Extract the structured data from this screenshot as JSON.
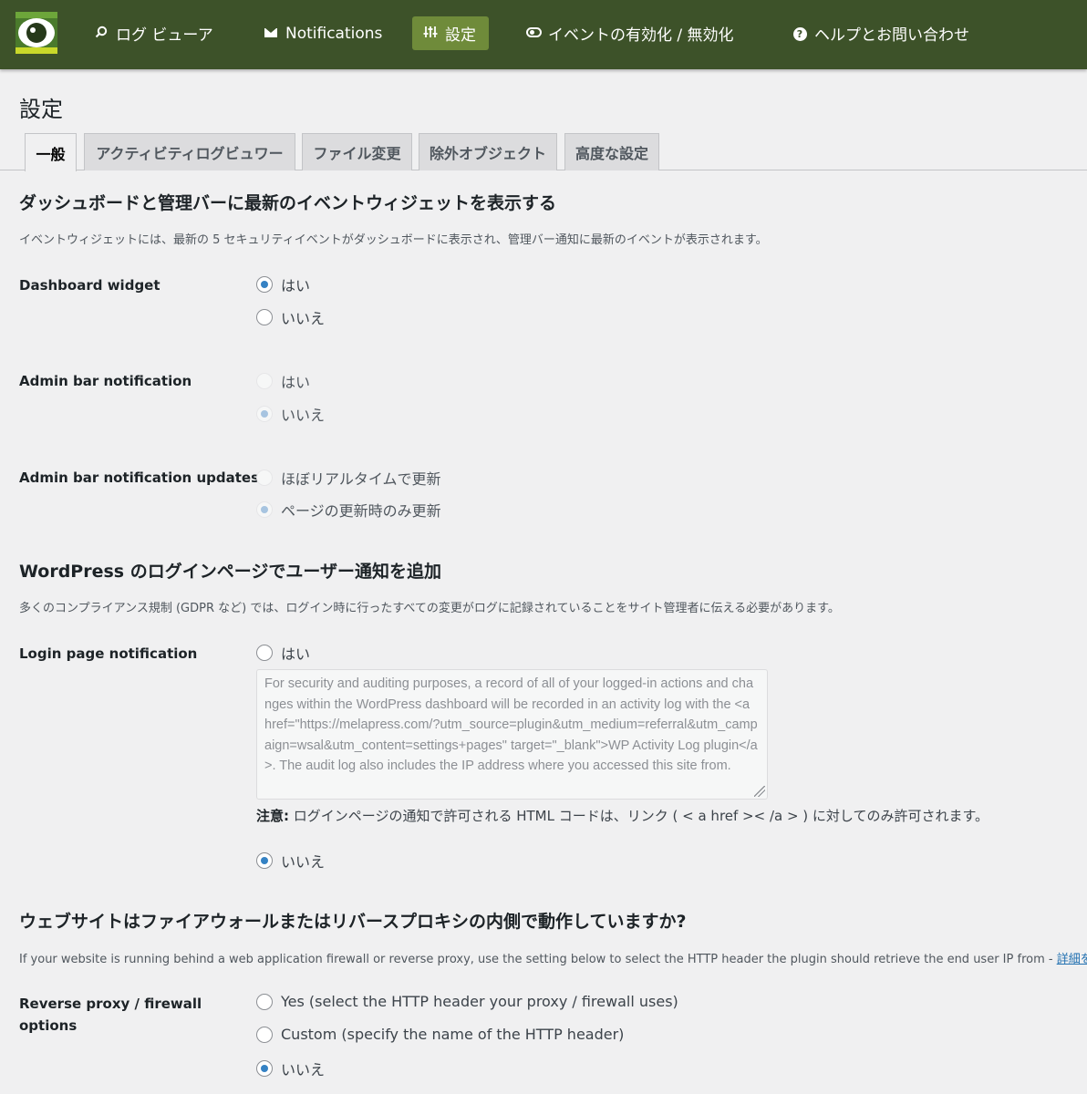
{
  "nav": {
    "logo_icon": "wsal-eye-logo",
    "items": [
      {
        "icon": "search-icon",
        "label": "ログ ビューア"
      },
      {
        "icon": "mail-icon",
        "label": "Notifications"
      },
      {
        "icon": "sliders-icon",
        "label": "設定"
      },
      {
        "icon": "toggle-icon",
        "label": "イベントの有効化 / 無効化"
      },
      {
        "icon": "help-icon",
        "label": "ヘルプとお問い合わせ"
      }
    ],
    "active_color": "#6f8b3a",
    "bar_color": "#3d5229"
  },
  "page": {
    "title": "設定",
    "tabs": [
      "一般",
      "アクティビティログビュワー",
      "ファイル変更",
      "除外オブジェクト",
      "高度な設定"
    ],
    "active_tab": "一般"
  },
  "sections": {
    "widget": {
      "heading": "ダッシュボードと管理バーに最新のイベントウィジェットを表示する",
      "description": "イベントウィジェットには、最新の 5 セキュリティイベントがダッシュボードに表示され、管理バー通知に最新のイベントが表示されます。",
      "dashboard_widget": {
        "label": "Dashboard widget",
        "options": [
          "はい",
          "いいえ"
        ],
        "selected": "はい"
      },
      "admin_bar_notification": {
        "label": "Admin bar notification",
        "options": [
          "はい",
          "いいえ"
        ],
        "selected": "いいえ",
        "disabled": true
      },
      "admin_bar_updates": {
        "label": "Admin bar notification updates",
        "options": [
          "ほぼリアルタイムで更新",
          "ページの更新時のみ更新"
        ],
        "selected": "ページの更新時のみ更新",
        "disabled": true
      }
    },
    "login": {
      "heading": "WordPress のログインページでユーザー通知を追加",
      "description": "多くのコンプライアンス規制 (GDPR など) では、ログイン時に行ったすべての変更がログに記録されていることをサイト管理者に伝える必要があります。",
      "label": "Login page notification",
      "option_yes": "はい",
      "option_no": "いいえ",
      "selected": "いいえ",
      "textarea_value": "For security and auditing purposes, a record of all of your logged-in actions and changes within the WordPress dashboard will be recorded in an activity log with the <a href=\"https://melapress.com/?utm_source=plugin&utm_medium=referral&utm_campaign=wsal&utm_content=settings+pages\" target=\"_blank\">WP Activity Log plugin</a>. The audit log also includes the IP address where you accessed this site from.",
      "note_bold": "注意:",
      "note_text": " ログインページの通知で許可される HTML コードは、リンク ( < a href >< /a > ) に対してのみ許可されます。"
    },
    "proxy": {
      "heading": "ウェブサイトはファイアウォールまたはリバースプロキシの内側で動作していますか?",
      "description": "If your website is running behind a web application firewall or reverse proxy, use the setting below to select the HTTP header the plugin should retrieve the end user IP from - ",
      "link": "詳細を",
      "label_line1": "Reverse proxy / firewall",
      "label_line2": "options",
      "options": [
        "Yes (select the HTTP header your proxy / firewall uses)",
        "Custom (specify the name of the HTTP header)",
        "いいえ"
      ],
      "selected": "いいえ"
    }
  }
}
